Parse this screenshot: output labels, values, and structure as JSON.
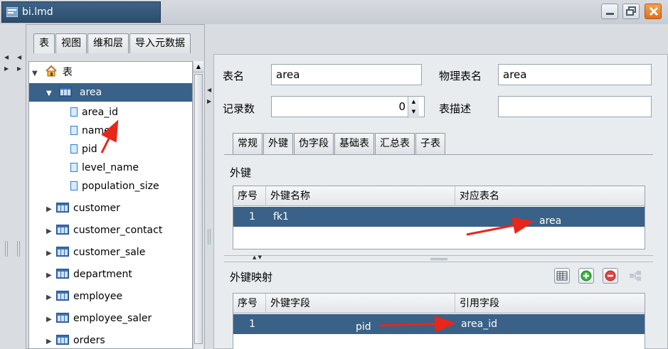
{
  "window": {
    "title": "bi.lmd"
  },
  "nav_tabs": [
    "表",
    "视图",
    "维和层",
    "导入元数据"
  ],
  "tree": {
    "root": "表",
    "selected_table": "area",
    "fields": [
      "area_id",
      "name",
      "pid",
      "level_name",
      "population_size"
    ],
    "tables": [
      "customer",
      "customer_contact",
      "customer_sale",
      "department",
      "employee",
      "employee_saler",
      "orders"
    ]
  },
  "form": {
    "table_name_label": "表名",
    "table_name_value": "area",
    "physical_name_label": "物理表名",
    "physical_name_value": "area",
    "record_count_label": "记录数",
    "record_count_value": "0",
    "description_label": "表描述",
    "description_value": ""
  },
  "sub_tabs": [
    "常规",
    "外键",
    "伪字段",
    "基础表",
    "汇总表",
    "子表"
  ],
  "foreign_keys": {
    "title": "外键",
    "columns": [
      "序号",
      "外键名称",
      "对应表名"
    ],
    "rows": [
      {
        "index": "1",
        "name": "fk1",
        "table": "area"
      }
    ]
  },
  "fk_mapping": {
    "title": "外键映射",
    "columns": [
      "序号",
      "外键字段",
      "引用字段"
    ],
    "rows": [
      {
        "index": "1",
        "field": "pid",
        "ref": "area_id"
      }
    ]
  },
  "icons": [
    "table-icon",
    "field-icon",
    "home-icon",
    "minimize-icon",
    "restore-icon",
    "close-icon",
    "grid-icon",
    "add-icon",
    "remove-icon",
    "relation-icon"
  ],
  "colors": {
    "selection": "#3a6187",
    "annotation_arrow": "#e8261a"
  }
}
